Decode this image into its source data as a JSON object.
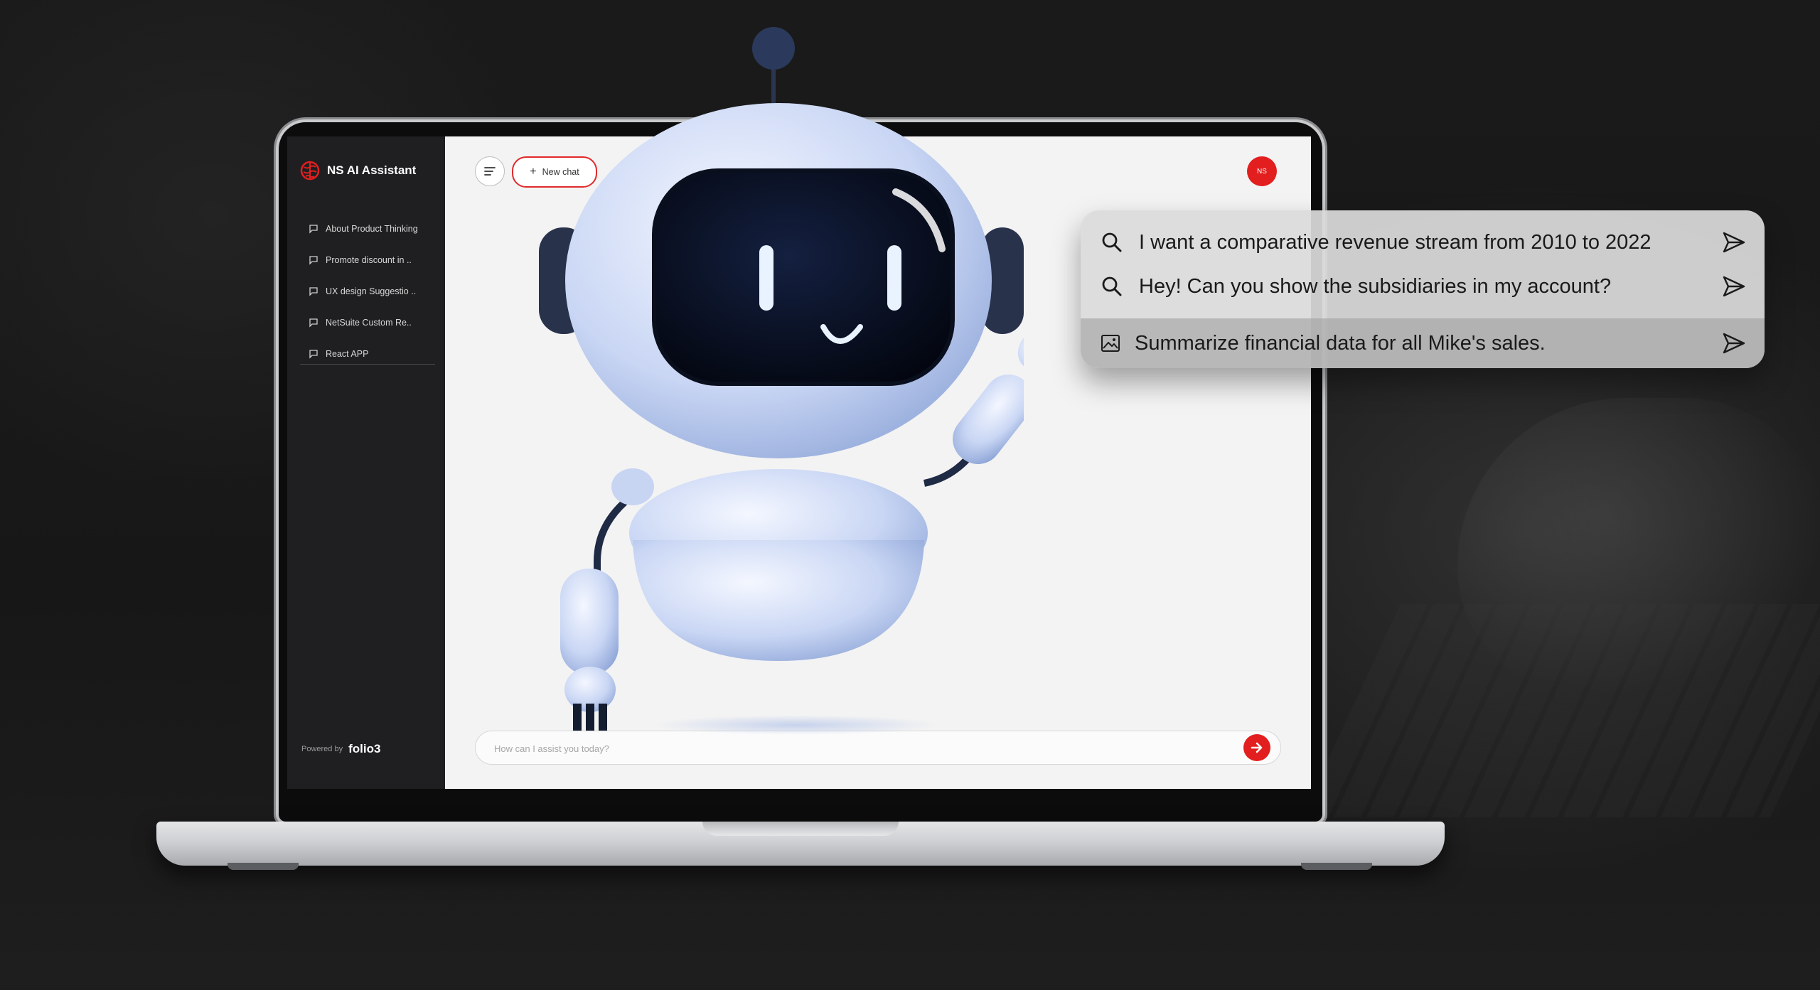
{
  "app": {
    "title": "NS AI Assistant",
    "brand_color": "#e21e1e"
  },
  "sidebar": {
    "items": [
      {
        "label": "About Product Thinking",
        "icon": "chat-bubble-icon"
      },
      {
        "label": "Promote discount in ..",
        "icon": "chat-bubble-icon"
      },
      {
        "label": "UX design Suggestio ..",
        "icon": "chat-bubble-icon"
      },
      {
        "label": "NetSuite Custom Re..",
        "icon": "chat-bubble-icon"
      },
      {
        "label": "React APP",
        "icon": "chat-bubble-icon"
      }
    ],
    "powered_label": "Powered by",
    "powered_brand": "folio3"
  },
  "header": {
    "new_chat_label": "New chat",
    "avatar_initials": "NS"
  },
  "composer": {
    "placeholder": "How can I assist you today?"
  },
  "suggestions": [
    {
      "text": "I want a comparative revenue stream from 2010 to 2022",
      "icon": "search-icon"
    },
    {
      "text": "Hey! Can you show the subsidiaries in my account?",
      "icon": "search-icon"
    },
    {
      "text": "Summarize financial data for all Mike's sales.",
      "icon": "image-icon"
    }
  ]
}
